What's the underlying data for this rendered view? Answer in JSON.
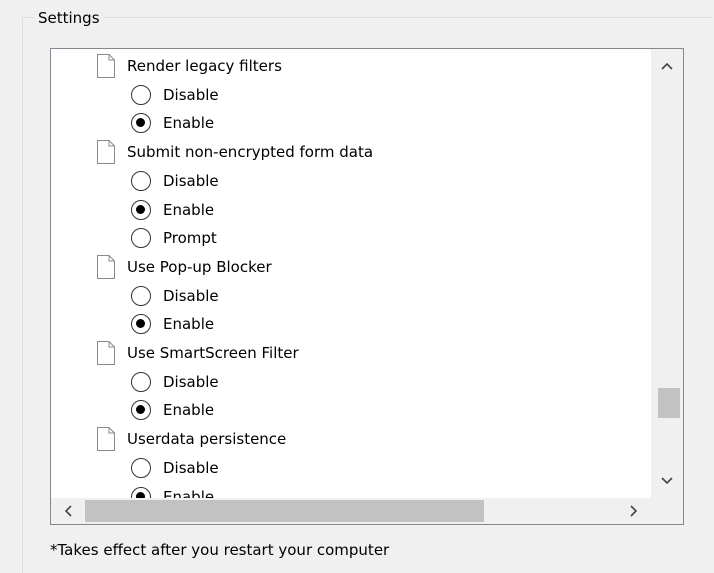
{
  "settings": {
    "group_title": "Settings",
    "footnote": "*Takes effect after you restart your computer"
  },
  "tree": {
    "policies": [
      {
        "label": "Render legacy filters",
        "options": [
          {
            "label": "Disable",
            "selected": false
          },
          {
            "label": "Enable",
            "selected": true
          }
        ]
      },
      {
        "label": "Submit non-encrypted form data",
        "options": [
          {
            "label": "Disable",
            "selected": false
          },
          {
            "label": "Enable",
            "selected": true
          },
          {
            "label": "Prompt",
            "selected": false
          }
        ]
      },
      {
        "label": "Use Pop-up Blocker",
        "options": [
          {
            "label": "Disable",
            "selected": false
          },
          {
            "label": "Enable",
            "selected": true
          }
        ]
      },
      {
        "label": "Use SmartScreen Filter",
        "options": [
          {
            "label": "Disable",
            "selected": false
          },
          {
            "label": "Enable",
            "selected": true
          }
        ]
      },
      {
        "label": "Userdata persistence",
        "options": [
          {
            "label": "Disable",
            "selected": false
          },
          {
            "label": "Enable",
            "selected": true
          }
        ]
      }
    ]
  },
  "scrollbars": {
    "vertical": {
      "thumb_start": 0.8,
      "thumb_fraction": 0.08
    },
    "horizontal": {
      "thumb_start": 0.0,
      "thumb_fraction": 0.75
    }
  },
  "icons": {
    "document": "document-icon",
    "scroll_up": "chevron-up-icon",
    "scroll_down": "chevron-down-icon",
    "scroll_left": "chevron-left-icon",
    "scroll_right": "chevron-right-icon"
  },
  "colors": {
    "window_bg": "#f0f0f0",
    "list_bg": "#ffffff",
    "list_border": "#828790",
    "scroll_thumb": "#c2c2c2"
  }
}
